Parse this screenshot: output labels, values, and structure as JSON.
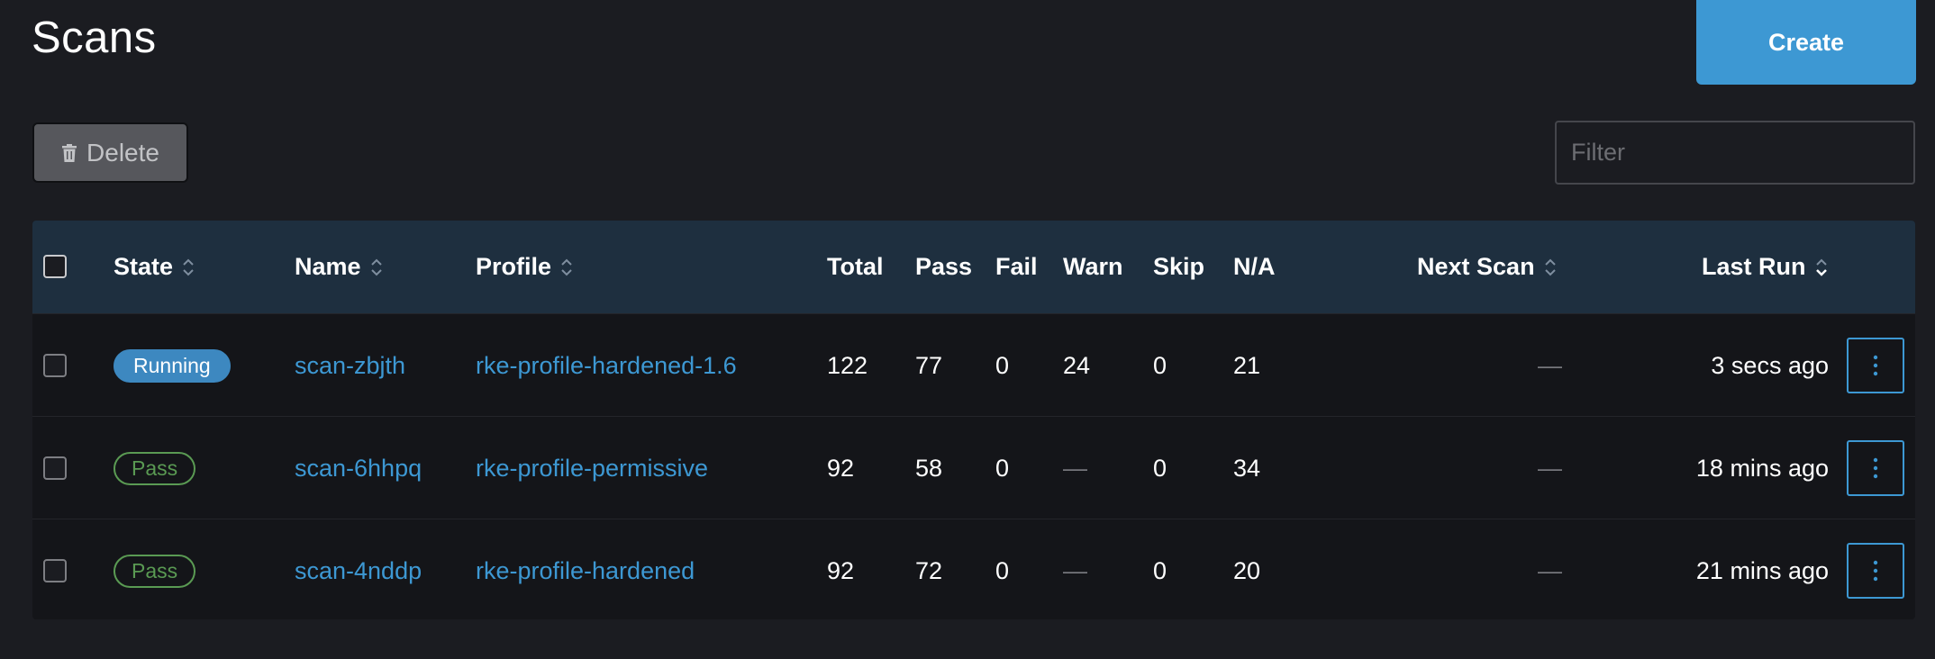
{
  "header": {
    "title": "Scans",
    "create_label": "Create"
  },
  "toolbar": {
    "delete_label": "Delete",
    "filter_placeholder": "Filter",
    "filter_value": ""
  },
  "table": {
    "columns": {
      "state": "State",
      "name": "Name",
      "profile": "Profile",
      "total": "Total",
      "pass": "Pass",
      "fail": "Fail",
      "warn": "Warn",
      "skip": "Skip",
      "na": "N/A",
      "next_scan": "Next Scan",
      "last_run": "Last Run"
    },
    "rows": [
      {
        "state": "Running",
        "name": "scan-zbjth",
        "profile": "rke-profile-hardened-1.6",
        "total": "122",
        "pass": "77",
        "fail": "0",
        "warn": "24",
        "skip": "0",
        "na": "21",
        "next_scan": "—",
        "last_run": "3 secs ago"
      },
      {
        "state": "Pass",
        "name": "scan-6hhpq",
        "profile": "rke-profile-permissive",
        "total": "92",
        "pass": "58",
        "fail": "0",
        "warn": "—",
        "skip": "0",
        "na": "34",
        "next_scan": "—",
        "last_run": "18 mins ago"
      },
      {
        "state": "Pass",
        "name": "scan-4nddp",
        "profile": "rke-profile-hardened",
        "total": "92",
        "pass": "72",
        "fail": "0",
        "warn": "—",
        "skip": "0",
        "na": "20",
        "next_scan": "—",
        "last_run": "21 mins ago"
      }
    ]
  },
  "icons": {
    "delete": "trash-icon",
    "sort": "sort-icon",
    "sort_active": "sort-down-icon",
    "actions": "kebab-menu-icon"
  },
  "colors": {
    "accent": "#3d98d3",
    "running": "#3d88c0",
    "pass": "#5a9a53",
    "header_bg": "#1e2f3f",
    "page_bg": "#1b1c21"
  }
}
